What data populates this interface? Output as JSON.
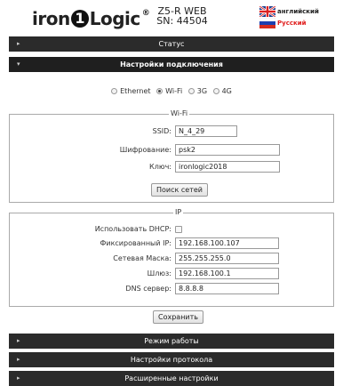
{
  "header": {
    "logo_left": "iron",
    "logo_circle": "1",
    "logo_right": "Logic",
    "logo_reg": "®",
    "model": "Z5-R WEB",
    "serial": "SN: 44504",
    "languages": [
      {
        "label": "английский",
        "flag": "uk-flag-icon"
      },
      {
        "label": "Русский",
        "flag": "ru-flag-icon"
      }
    ]
  },
  "sections": {
    "status": "Статус",
    "connection": "Настройки подключения",
    "mode": "Режим работы",
    "protocol": "Настройки протокола",
    "advanced": "Расширенные настройки"
  },
  "connection_types": [
    {
      "label": "Ethernet",
      "checked": false
    },
    {
      "label": "Wi-Fi",
      "checked": true
    },
    {
      "label": "3G",
      "checked": false
    },
    {
      "label": "4G",
      "checked": false
    }
  ],
  "wifi": {
    "legend": "Wi-Fi",
    "ssid_label": "SSID:",
    "ssid_value": "N_4_29",
    "enc_label": "Шифрование:",
    "enc_value": "psk2",
    "key_label": "Ключ:",
    "key_value": "ironlogic2018",
    "scan_button": "Поиск сетей"
  },
  "ip": {
    "legend": "IP",
    "dhcp_label": "Использовать DHCP:",
    "dhcp_checked": false,
    "fixed_ip_label": "Фиксированный IP:",
    "fixed_ip_value": "192.168.100.107",
    "mask_label": "Сетевая Маска:",
    "mask_value": "255.255.255.0",
    "gateway_label": "Шлюз:",
    "gateway_value": "192.168.100.1",
    "dns_label": "DNS сервер:",
    "dns_value": "8.8.8.8"
  },
  "save_button": "Сохранить",
  "colors": {
    "bar_background": "#2b2b2b",
    "bar_text": "#ffffff",
    "russian_label": "#e0201f"
  }
}
